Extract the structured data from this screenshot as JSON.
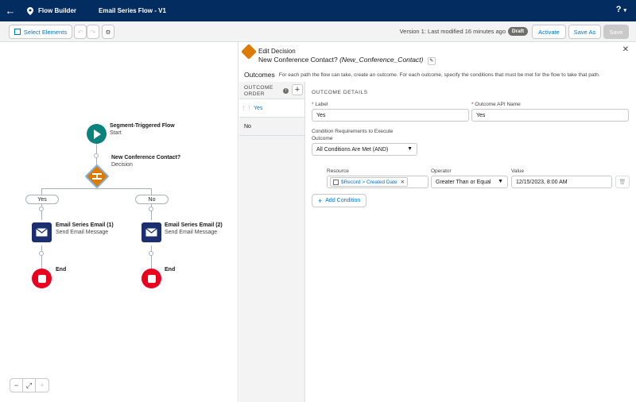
{
  "topbar": {
    "app_name": "Flow Builder",
    "flow_name": "Email Series Flow - V1",
    "help": "?"
  },
  "toolbar": {
    "select_elements": "Select Elements",
    "version_text": "Version 1: Last modified 16 minutes ago",
    "status": "Draft",
    "activate": "Activate",
    "save_as": "Save As",
    "save": "Save"
  },
  "canvas": {
    "start": {
      "title": "Segment-Triggered Flow",
      "sub": "Start"
    },
    "decision": {
      "title": "New Conference Contact?",
      "sub": "Decision"
    },
    "branches": [
      {
        "label": "Yes",
        "email_title": "Email Series Email (1)",
        "email_sub": "Send Email Message",
        "end": "End"
      },
      {
        "label": "No",
        "email_title": "Email Series Email (2)",
        "email_sub": "Send Email Message",
        "end": "End"
      }
    ]
  },
  "panel": {
    "title": "Edit Decision",
    "element_label": "New Conference Contact?",
    "element_api": "(New_Conference_Contact)",
    "outcomes_heading": "Outcomes",
    "outcomes_desc": "For each path the flow can take, create an outcome. For each outcome, specify the conditions that must be met for the flow to take that path.",
    "order_header": "OUTCOME ORDER",
    "outcomes": [
      "Yes",
      "No"
    ],
    "details_heading": "OUTCOME DETAILS",
    "label_label": "Label",
    "label_value": "Yes",
    "api_label": "Outcome API Name",
    "api_value": "Yes",
    "cond_req_label": "Condition Requirements to Execute Outcome",
    "cond_req_value": "All Conditions Are Met (AND)",
    "resource_label": "Resource",
    "resource_value": "$Record > Created Date",
    "operator_label": "Operator",
    "operator_value": "Greater Than or Equal",
    "value_label": "Value",
    "value_value": "12/15/2023, 8:00 AM",
    "add_condition": "Add Condition"
  },
  "colors": {
    "header": "#032d60",
    "start_node": "#0b827c",
    "decision_node": "#dd7a01",
    "email_node": "#1b2f70",
    "end_node": "#ea001e",
    "accent": "#0176d3"
  }
}
